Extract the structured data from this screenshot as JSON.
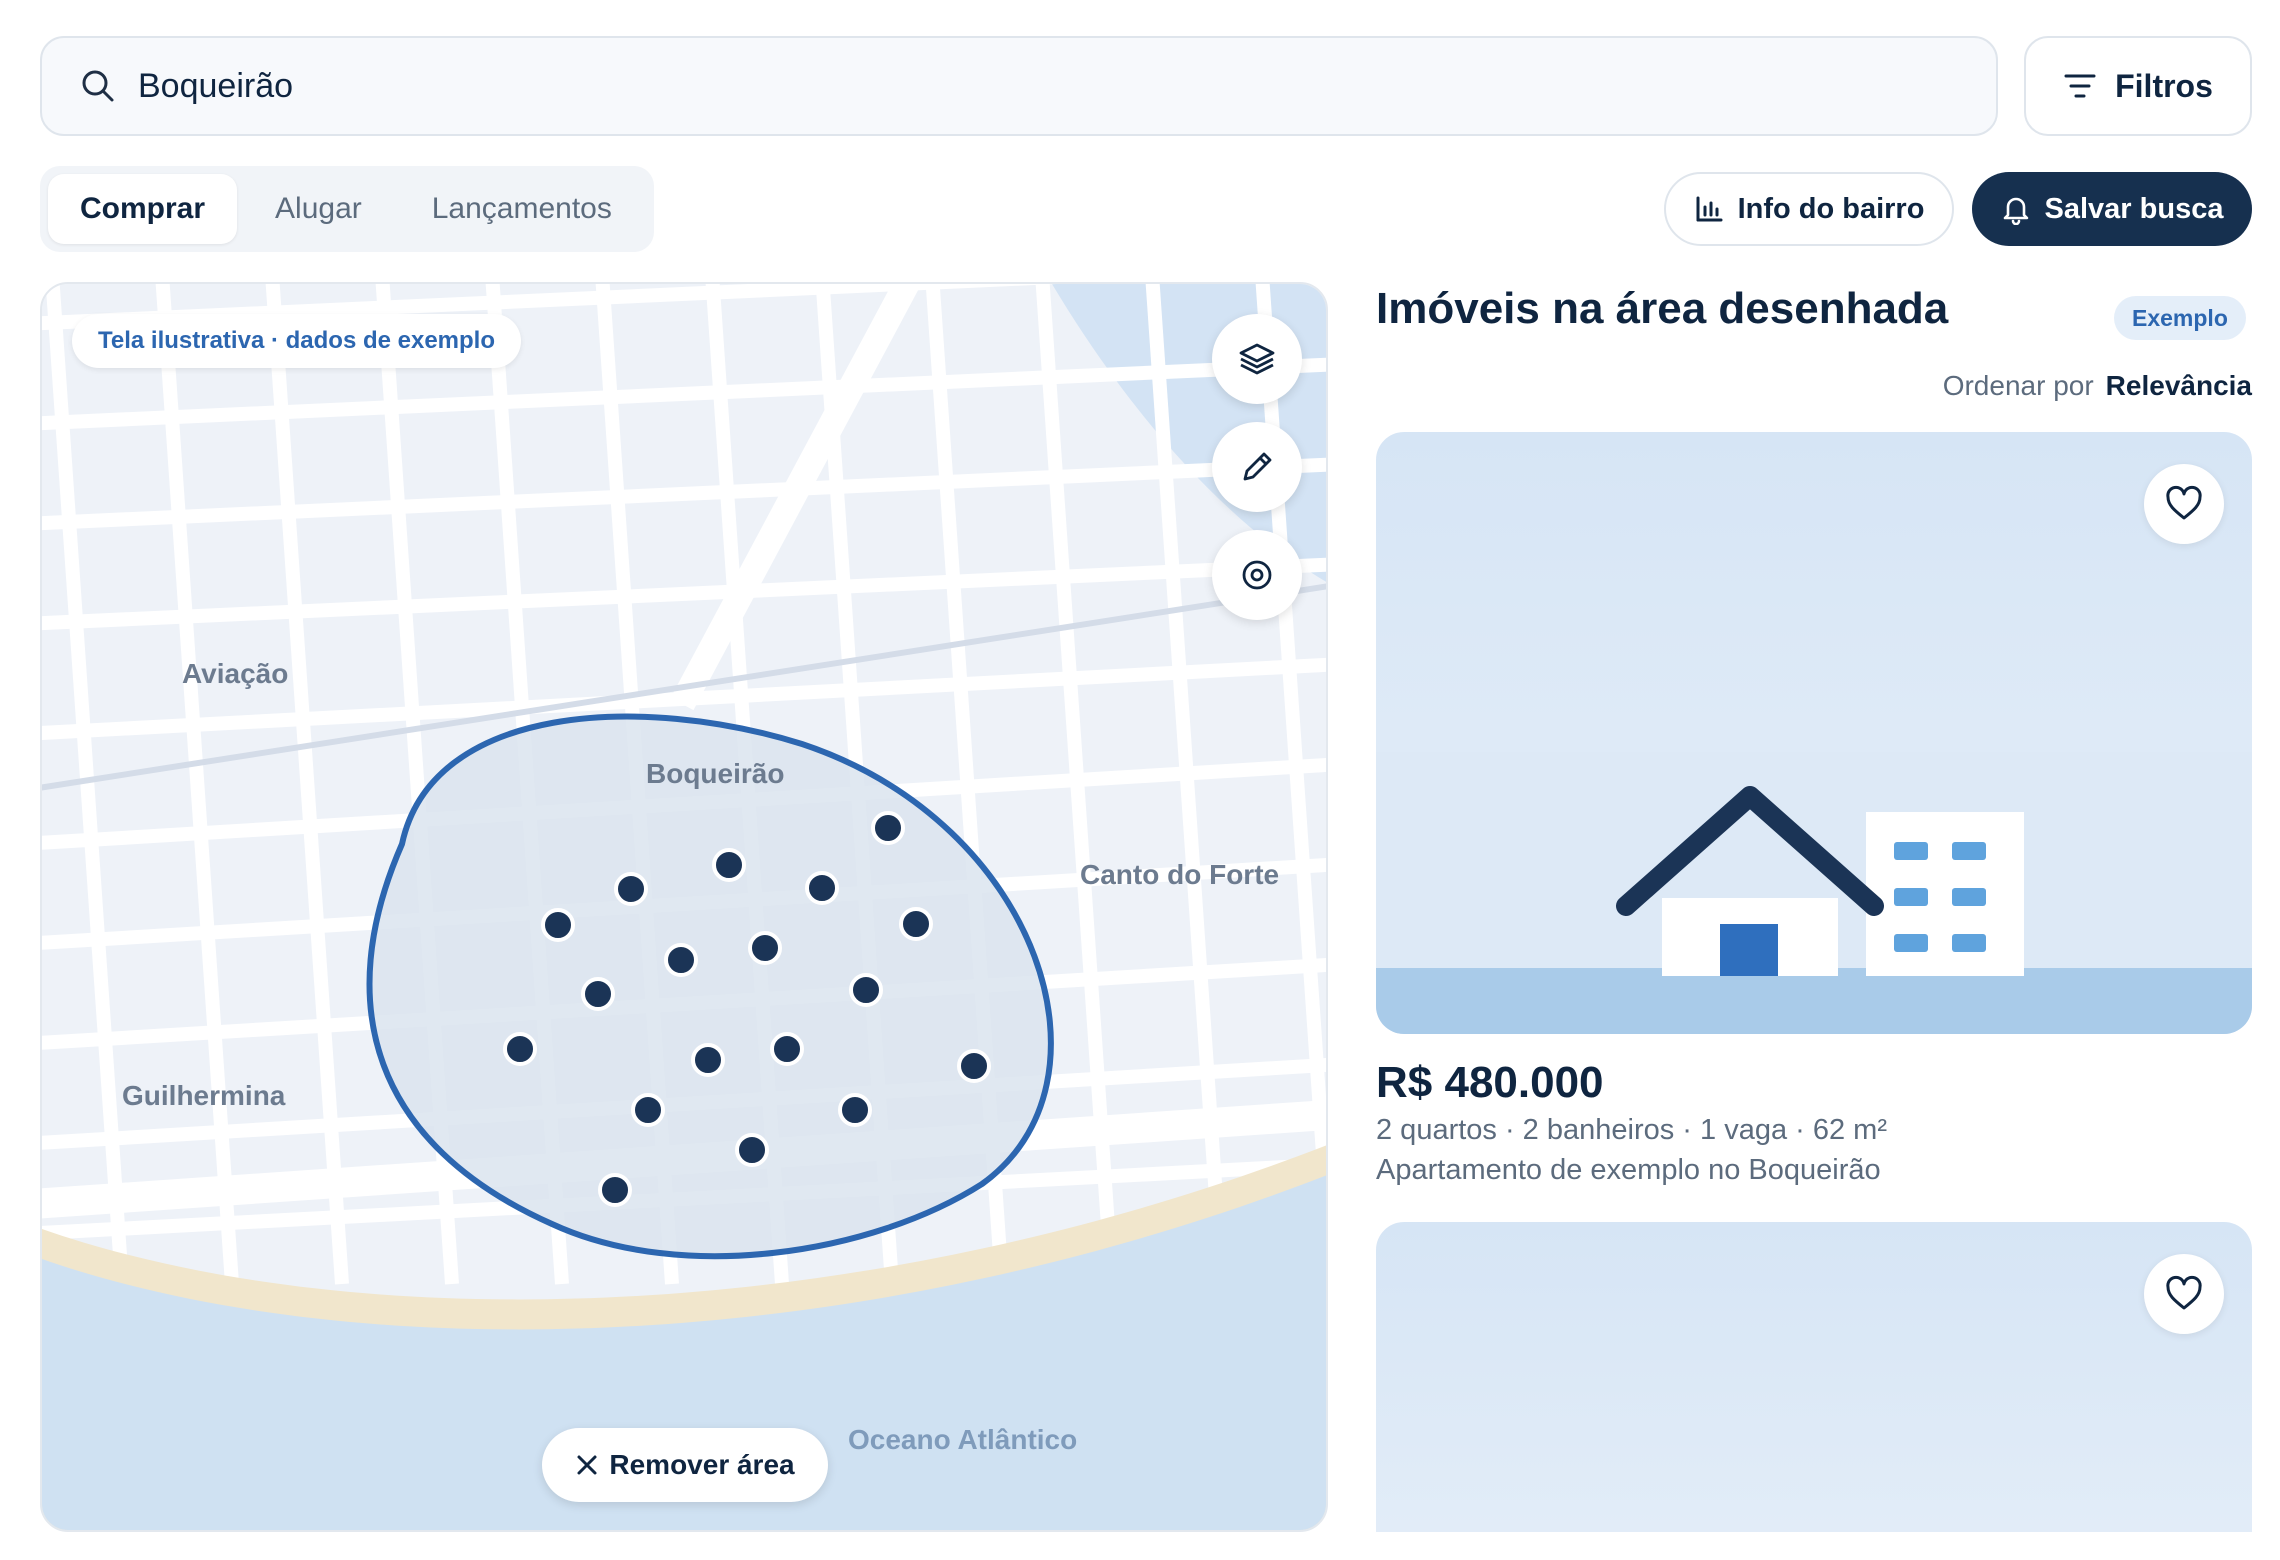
{
  "search": {
    "value": "Boqueirão",
    "filters_label": "Filtros"
  },
  "tabs": [
    {
      "label": "Comprar",
      "active": true
    },
    {
      "label": "Alugar",
      "active": false
    },
    {
      "label": "Lançamentos",
      "active": false
    }
  ],
  "actions": {
    "info_label": "Info do bairro",
    "save_label": "Salvar busca"
  },
  "map": {
    "note": "Tela ilustrativa · dados de exemplo",
    "labels": {
      "aviacao": "Aviação",
      "boqueirao": "Boqueirão",
      "canto_do_forte": "Canto do Forte",
      "guilhermina": "Guilhermina",
      "oceano": "Oceano Atlântico"
    },
    "remove_area_label": "Remover área",
    "controls": [
      "layers-icon",
      "pencil-icon",
      "locate-icon"
    ]
  },
  "results": {
    "title": "Imóveis na área desenhada",
    "badge": "Exemplo",
    "sort_label": "Ordenar por",
    "sort_value": "Relevância"
  },
  "listings": [
    {
      "price": "R$ 480.000",
      "details": "2 quartos · 2 banheiros · 1 vaga · 62 m²",
      "description": "Apartamento de exemplo no Boqueirão"
    }
  ],
  "colors": {
    "primary": "#16304f",
    "accent": "#2c66b0",
    "map_bg": "#eef2f8",
    "water": "#cfe1f2",
    "sand": "#f1e6cc",
    "area_fill": "#dae4ef",
    "pin": "#1b3456"
  }
}
